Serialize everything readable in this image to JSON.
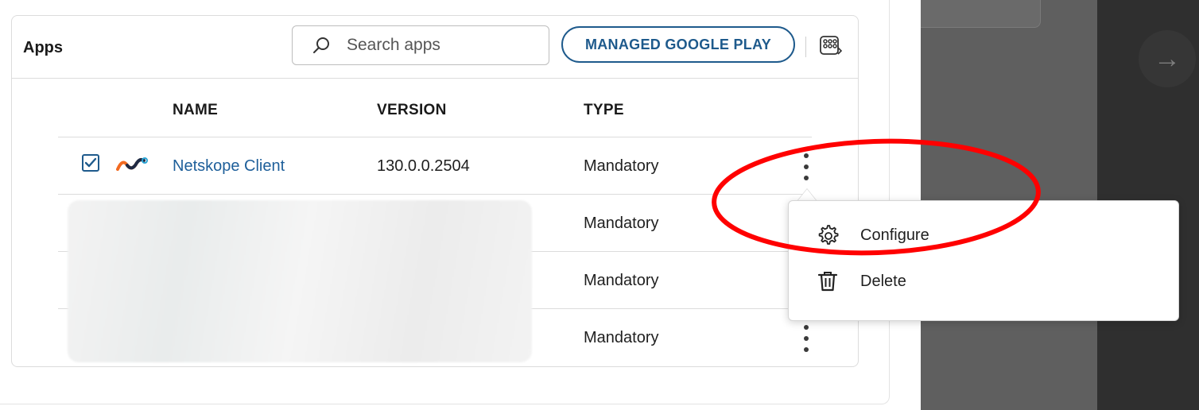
{
  "apps": {
    "title": "Apps",
    "search_placeholder": "Search apps",
    "managed_google_play": "MANAGED GOOGLE PLAY",
    "columns": {
      "name": "NAME",
      "version": "VERSION",
      "type": "TYPE"
    },
    "rows": [
      {
        "name": "Netskope Client",
        "version": "130.0.0.2504",
        "type": "Mandatory",
        "checked": true
      },
      {
        "name": "",
        "version": "",
        "type": "Mandatory"
      },
      {
        "name": "",
        "version": "",
        "type": "Mandatory"
      },
      {
        "name": "",
        "version": "",
        "type": "Mandatory"
      }
    ]
  },
  "context_menu": {
    "items": [
      {
        "label": "Configure",
        "icon": "gear-icon"
      },
      {
        "label": "Delete",
        "icon": "trash-icon"
      }
    ]
  },
  "icons": {
    "search": "search-icon",
    "export": "grid-export-icon",
    "next": "arrow-right-icon",
    "kebab": "more-vertical-icon"
  },
  "colors": {
    "accent": "#1e5a8c",
    "link": "#1e5f9a",
    "annotation": "#ff0000",
    "dark_pane": "#5f5f5f"
  }
}
